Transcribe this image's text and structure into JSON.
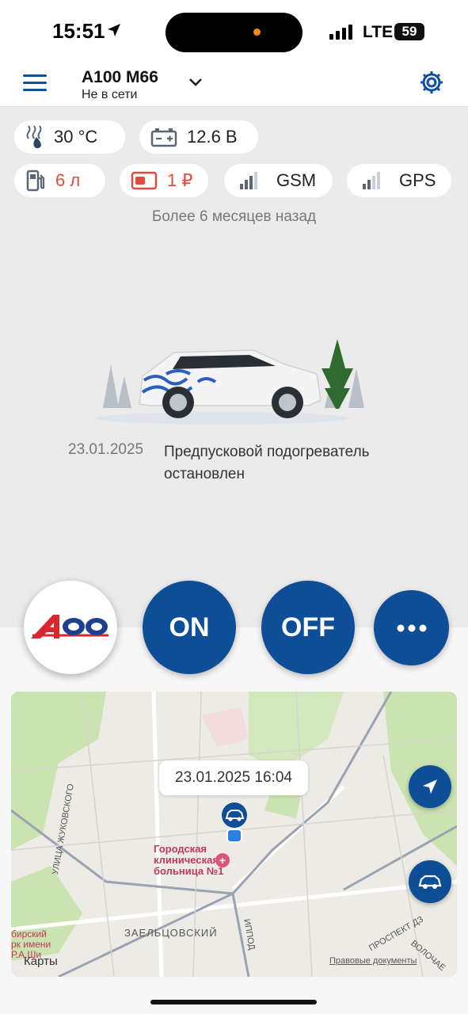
{
  "status_bar": {
    "time": "15:51",
    "network": "LTE",
    "battery": "59"
  },
  "header": {
    "title": "А100 М66",
    "subtitle": "Не в сети"
  },
  "chips": {
    "temperature": "30 °C",
    "voltage": "12.6 В",
    "fuel": "6 л",
    "balance": "1 ₽",
    "gsm": "GSM",
    "gps": "GPS"
  },
  "updated": "Более 6 месяцев назад",
  "event": {
    "date": "23.01.2025",
    "text": "Предпусковой подогреватель остановлен"
  },
  "buttons": {
    "on": "ON",
    "off": "OFF"
  },
  "map": {
    "timestamp": "23.01.2025 16:04",
    "labels": {
      "hospital_line1": "Городская",
      "hospital_line2": "клиническая",
      "hospital_line3": "больница №1",
      "district": "ЗАЕЛЬЦОВСКИЙ",
      "street1": "УЛИЦА ЖУКОВСКОГО",
      "street2": "ИППОД",
      "street3": "ПРОСПЕКТ ДЗ",
      "street4": "ВОЛОЧАЕ",
      "park1": "бирский",
      "park2": "рк имени",
      "park3": "Р.А.Ши",
      "attribution": "Карты",
      "legal": "Правовые документы"
    }
  },
  "colors": {
    "accent": "#0d4e96",
    "alert": "#e14a3c"
  }
}
